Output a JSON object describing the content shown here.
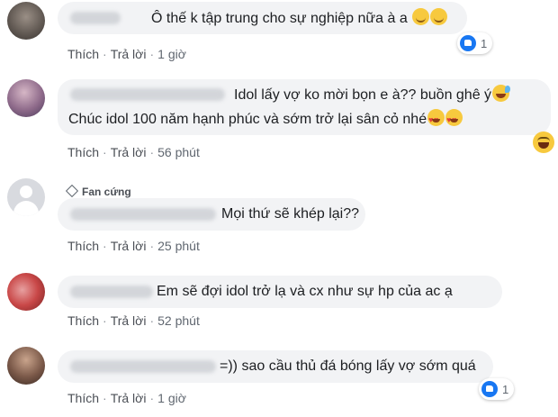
{
  "comments": [
    {
      "text": "Ô thế k tập trung cho sự nghiệp nữa à a",
      "emojis": [
        "smile-emoji",
        "smile-emoji"
      ],
      "actions": {
        "like": "Thích",
        "reply": "Trả lời",
        "time": "1 giờ"
      },
      "reaction": {
        "icon": "like-icon",
        "count": "1"
      }
    },
    {
      "text_line1": "Idol lấy vợ ko mời bọn e à?? buồn ghê ý",
      "text_line2": "Chúc idol 100 năm hạnh phúc và sớm trở lại sân cỏ nhé",
      "emojis_line1": [
        "sweat-smile-emoji"
      ],
      "emojis_line2": [
        "heart-eyes-emoji",
        "heart-eyes-emoji"
      ],
      "actions": {
        "like": "Thích",
        "reply": "Trả lời",
        "time": "56 phút"
      },
      "reaction": {
        "icon": "haha-icon"
      }
    },
    {
      "badge": "Fan cứng",
      "text": "Mọi thứ sẽ khép lại??",
      "actions": {
        "like": "Thích",
        "reply": "Trả lời",
        "time": "25 phút"
      }
    },
    {
      "text": "Em sẽ đợi idol trở lạ và cx như sự hp của ac ạ",
      "actions": {
        "like": "Thích",
        "reply": "Trả lời",
        "time": "52 phút"
      }
    },
    {
      "text": "=)) sao cầu thủ đá bóng lấy vợ sớm quá",
      "actions": {
        "like": "Thích",
        "reply": "Trả lời",
        "time": "1 giờ"
      },
      "reaction": {
        "icon": "like-icon",
        "count": "1"
      }
    }
  ],
  "separator": "·",
  "colors": {
    "bubble": "#f2f3f5",
    "like_blue": "#1877f2",
    "action_text": "#4b4f56"
  }
}
